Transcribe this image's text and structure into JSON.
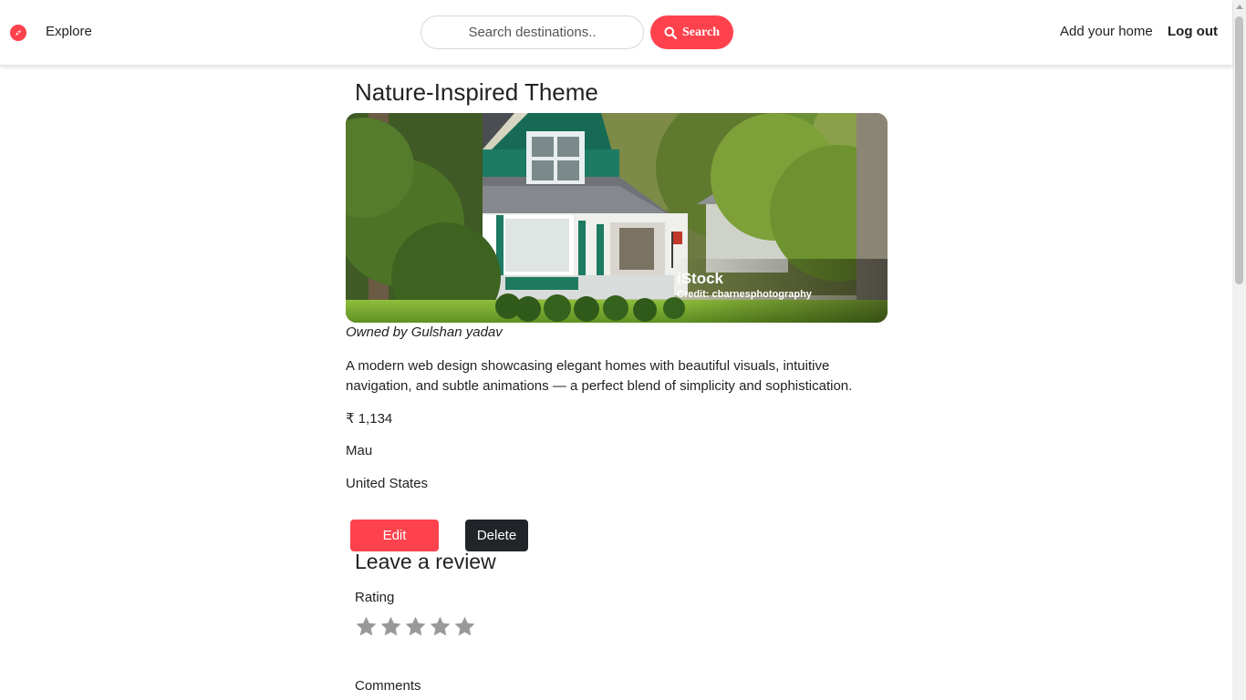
{
  "navbar": {
    "brand_icon": "compass-icon",
    "explore_label": "Explore",
    "search_placeholder": "Search destinations..",
    "search_button_label": "Search",
    "search_icon": "search-icon",
    "add_home_label": "Add your home",
    "logout_label": "Log out"
  },
  "listing": {
    "title": "Nature-Inspired Theme",
    "image_watermark": "iStock",
    "image_credit": "Credit: cbarnesphotography",
    "owner": "Owned by Gulshan yadav",
    "description": "A modern web design showcasing elegant homes with beautiful visuals, intuitive navigation, and subtle animations — a perfect blend of simplicity and sophistication.",
    "price": "₹ 1,134",
    "location": "Mau",
    "country": "United States",
    "edit_label": "Edit",
    "delete_label": "Delete"
  },
  "review": {
    "heading": "Leave a review",
    "rating_label": "Rating",
    "star_count": 5,
    "selected_rating": 0,
    "comments_label": "Comments"
  },
  "colors": {
    "accent": "#fe424d",
    "dark_button": "#212529",
    "star_inactive": "#999999"
  }
}
